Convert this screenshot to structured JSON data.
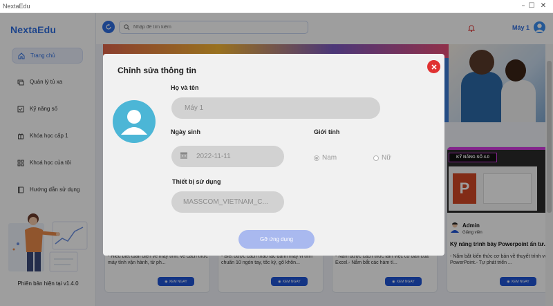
{
  "window": {
    "title": "NextaEdu"
  },
  "sidebar": {
    "logo": "NextaEdu",
    "items": [
      {
        "label": "Trang chủ",
        "icon": "home-icon",
        "active": true
      },
      {
        "label": "Quản lý tủ xa",
        "icon": "remote-icon",
        "active": false
      },
      {
        "label": "Kỹ năng số",
        "icon": "checklist-icon",
        "active": false
      },
      {
        "label": "Khóa học cấp 1",
        "icon": "gift-icon",
        "active": false
      },
      {
        "label": "Khoá học của tôi",
        "icon": "grid-icon",
        "active": false
      },
      {
        "label": "Hướng dẫn sử dụng",
        "icon": "book-icon",
        "active": false
      }
    ],
    "version": "Phiên bản hiện tại v1.4.0"
  },
  "topbar": {
    "search_placeholder": "Nhập để tìm kiếm",
    "user_name": "Máy 1"
  },
  "cards": [
    {
      "desc": "- Hiểu biết toàn diện về máy tính, về cách thức máy tính vận hành, từ ph...",
      "view_label": "XEM NGAY"
    },
    {
      "desc": "- Biết được cách thao tác đánh máy vi tính chuẩn 10 ngón tay, tốc ký, gõ khôn...",
      "view_label": "XEM NGAY"
    },
    {
      "desc": "- Nắm được cách thức làm việc cơ bản của Excel.- Nắm bắt các hàm tí...",
      "view_label": "XEM NGAY"
    },
    {
      "author": "Admin",
      "role": "Giảng viên",
      "badge": "KỸ NĂNG SỐ 4.0",
      "title": "Kỹ năng trình bày Powerpoint ấn tư...",
      "desc": "- Nắm bắt kiến thức cơ bản về thuyết trình với PowerPoint.- Tự phát triển ...",
      "view_label": "XEM NGAY"
    }
  ],
  "modal": {
    "title": "Chỉnh sửa thông tin",
    "name_label": "Họ và tên",
    "name_value": "Máy 1",
    "dob_label": "Ngày sinh",
    "dob_value": "2022-11-11",
    "gender_label": "Giới tính",
    "gender_options": [
      "Nam",
      "Nữ"
    ],
    "gender_selected": "Nam",
    "device_label": "Thiết bị sử dụng",
    "device_value": "MASSCOM_VIETNAM_C...",
    "submit_label": "Gỡ ứng dụng"
  },
  "colors": {
    "accent": "#2f6fe0",
    "close": "#e03131",
    "avatar": "#4cb6d6",
    "submit": "#a9b9ef"
  }
}
